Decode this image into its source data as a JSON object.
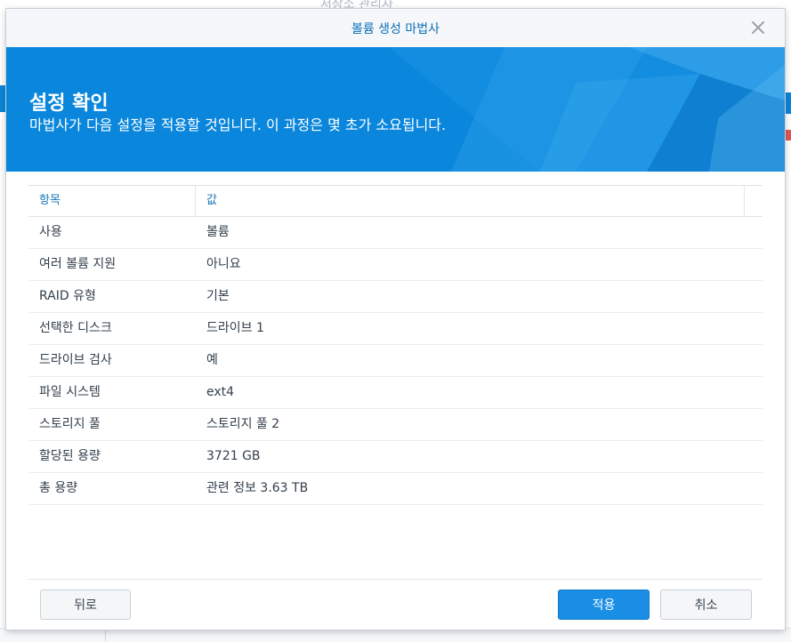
{
  "background": {
    "app_title": "저장소 관리자"
  },
  "dialog": {
    "title": "볼륨 생성 마법사",
    "banner": {
      "title": "설정 확인",
      "subtitle": "마법사가 다음 설정을 적용할 것입니다. 이 과정은 몇 초가 소요됩니다."
    },
    "table": {
      "headers": {
        "item": "항목",
        "value": "값"
      },
      "rows": [
        {
          "item": "사용",
          "value": "볼륨"
        },
        {
          "item": "여러 볼륨 지원",
          "value": "아니요"
        },
        {
          "item": "RAID 유형",
          "value": "기본"
        },
        {
          "item": "선택한 디스크",
          "value": "드라이브 1"
        },
        {
          "item": "드라이브 검사",
          "value": "예"
        },
        {
          "item": "파일 시스템",
          "value": "ext4"
        },
        {
          "item": "스토리지 풀",
          "value": "스토리지 풀 2"
        },
        {
          "item": "할당된 용량",
          "value": "3721 GB"
        },
        {
          "item": "총 용량",
          "value": "관련 정보 3.63 TB"
        }
      ]
    },
    "buttons": {
      "back": "뒤로",
      "apply": "적용",
      "cancel": "취소"
    }
  },
  "colors": {
    "accent": "#0a86dc",
    "title_text": "#0a6fb5",
    "header_text": "#1a76b8",
    "primary_button": "#1a8ee5"
  },
  "icons": {
    "close": "close-icon"
  }
}
